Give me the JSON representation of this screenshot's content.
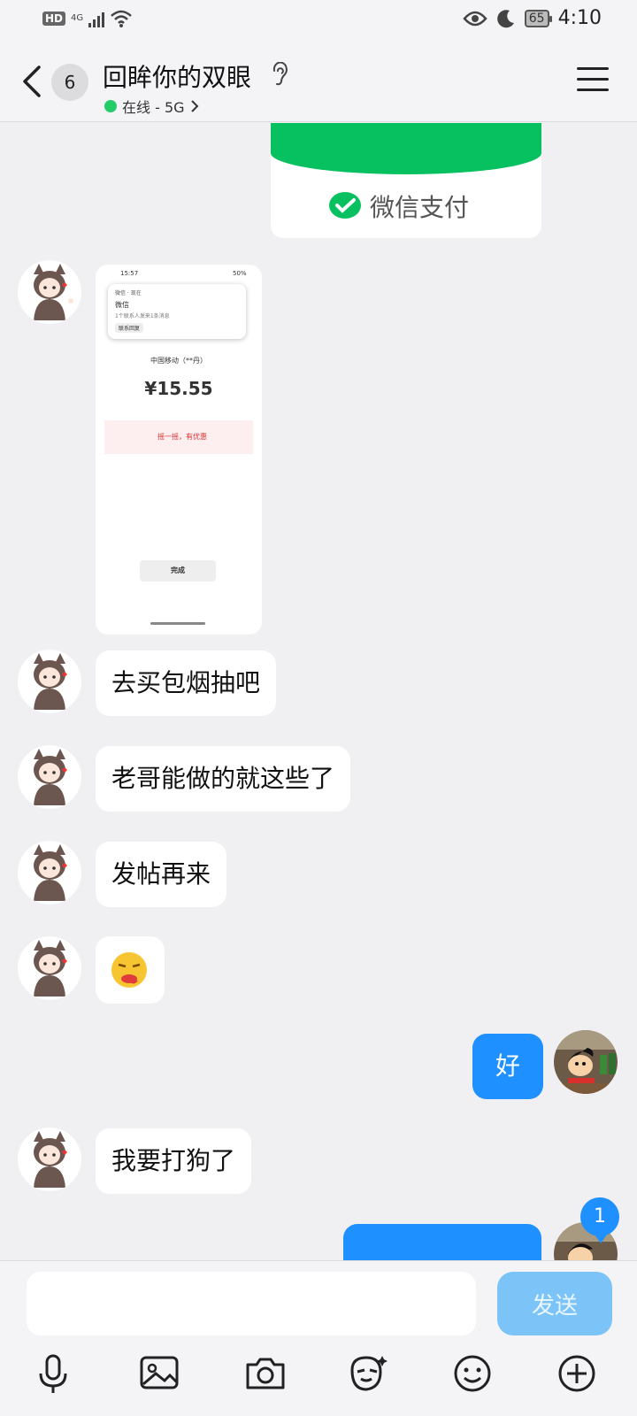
{
  "status_bar": {
    "hd_label": "HD",
    "network_label": "4G",
    "battery": "65",
    "time": "4:10"
  },
  "header": {
    "unread_count": "6",
    "title": "回眸你的双眼",
    "status": "在线 - 5G"
  },
  "messages": {
    "wechat_pay_label": "微信支付",
    "screenshot": {
      "time": "15:57",
      "battery": "50%",
      "notif_app": "微信 · 现在",
      "notif_title": "微信",
      "notif_body": "1个联系人发来1条消息",
      "notif_button": "联系回复",
      "merchant": "中国移动（**丹）",
      "amount": "¥15.55",
      "promo": "摇一摇，有优惠",
      "done": "完成"
    },
    "m1": "去买包烟抽吧",
    "m2": "老哥能做的就这些了",
    "m3": "发帖再来",
    "m4_emoji": "😝",
    "m5_self": "好",
    "m6": "我要打狗了",
    "unread_badge": "1"
  },
  "input": {
    "placeholder": "",
    "send_label": "发送"
  },
  "colors": {
    "accent": "#1e90ff",
    "send_disabled": "#7cc4f8",
    "online": "#22cc66",
    "wechat_green": "#07c160"
  },
  "icons": [
    "back-icon",
    "ear-icon",
    "menu-icon",
    "microphone-icon",
    "image-icon",
    "camera-icon",
    "sticker-icon",
    "emoji-icon",
    "plus-icon"
  ]
}
